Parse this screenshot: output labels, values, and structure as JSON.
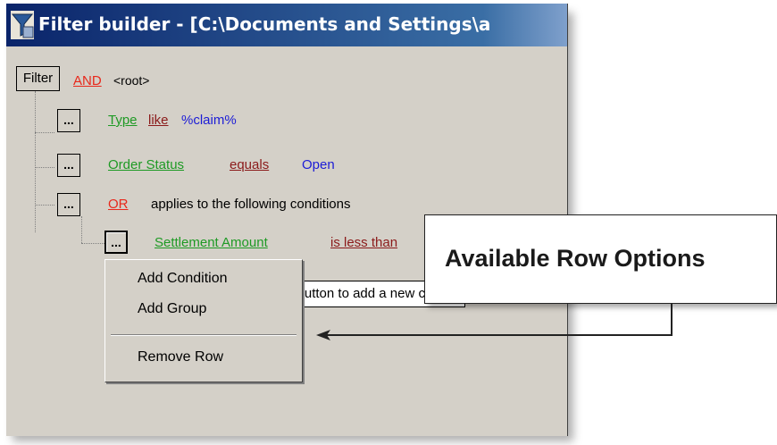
{
  "window": {
    "title": "Filter builder - [C:\\Documents and Settings\\a"
  },
  "filter": {
    "root_button": "Filter",
    "root_operator": "AND",
    "root_label": "<root>"
  },
  "rows": [
    {
      "button": "...",
      "field": "Type",
      "operator": "like",
      "value": "%claim%"
    },
    {
      "button": "...",
      "field": "Order Status",
      "operator": "equals",
      "value": "Open"
    },
    {
      "button": "...",
      "operator": "OR",
      "text": "applies to the following conditions"
    },
    {
      "button": "...",
      "field": "Settlement Amount",
      "operator": "is less than"
    }
  ],
  "add_hint": "Press the button to add a new condition",
  "context_menu": {
    "items": [
      "Add Condition",
      "Add Group",
      "Remove Row"
    ]
  },
  "callout": {
    "text": "Available Row Options"
  },
  "colors": {
    "operator_logic": "#e8281b",
    "field": "#1e9a24",
    "operator": "#8b1a1a",
    "value": "#1c1cd6",
    "title_bar": "#0a246a"
  }
}
